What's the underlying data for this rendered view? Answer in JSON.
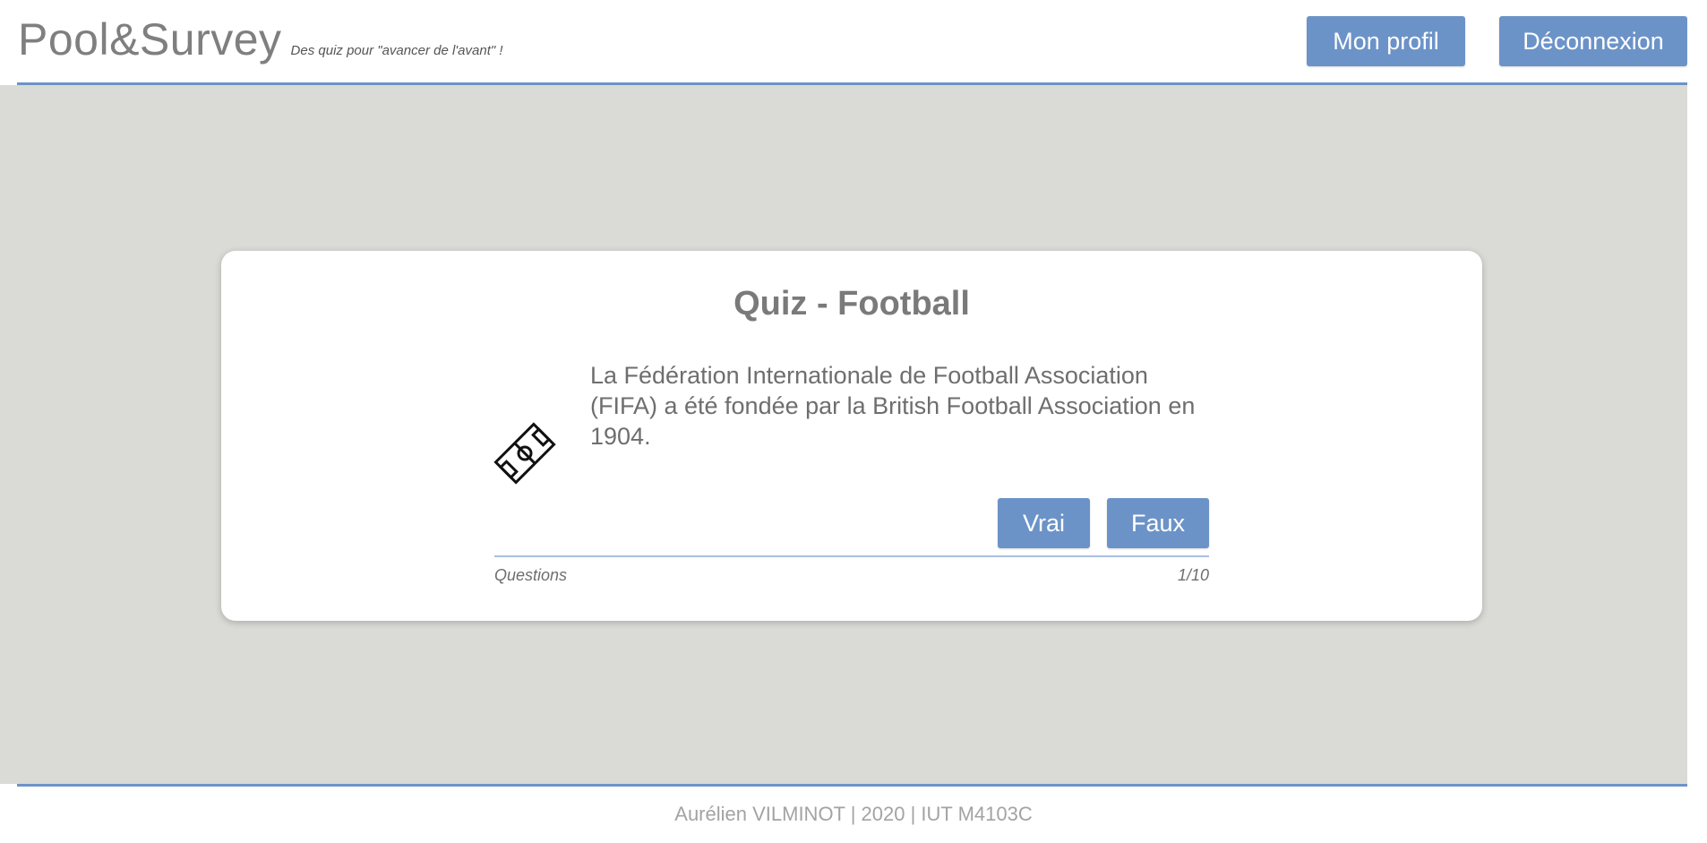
{
  "header": {
    "brand_title": "Pool&Survey",
    "tagline": "Des quiz pour \"avancer de l'avant\" !",
    "profile_label": "Mon profil",
    "logout_label": "Déconnexion"
  },
  "quiz": {
    "title": "Quiz - Football",
    "icon": "football-field-icon",
    "question": "La Fédération Internationale de Football Association (FIFA) a été fondée par la British Football Association en 1904.",
    "true_label": "Vrai",
    "false_label": "Faux",
    "progress_label": "Questions",
    "progress_value": "1/10"
  },
  "footer": {
    "text": "Aurélien VILMINOT | 2020 | IUT M4103C"
  },
  "colors": {
    "accent": "#6c93c8",
    "background": "#dadad6",
    "card": "#ffffff",
    "text": "#7a7a7a"
  }
}
